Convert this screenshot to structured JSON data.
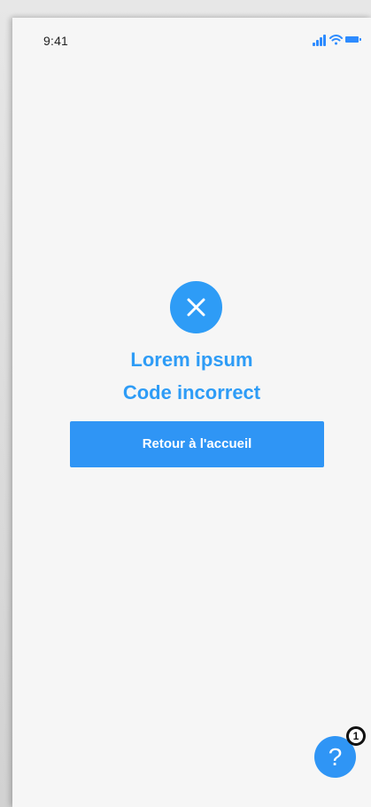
{
  "status_bar": {
    "time": "9:41",
    "icons": [
      "signal-icon",
      "wifi-icon",
      "battery-icon"
    ]
  },
  "colors": {
    "accent": "#2e9cf6",
    "button": "#2f95f5",
    "background": "#f6f6f6"
  },
  "message": {
    "icon": "close-icon",
    "line_1": "Lorem ipsum",
    "line_2": "Code incorrect"
  },
  "actions": {
    "home_button": "Retour à l'accueil"
  },
  "help": {
    "fab_symbol": "?",
    "badge_count": "1"
  }
}
